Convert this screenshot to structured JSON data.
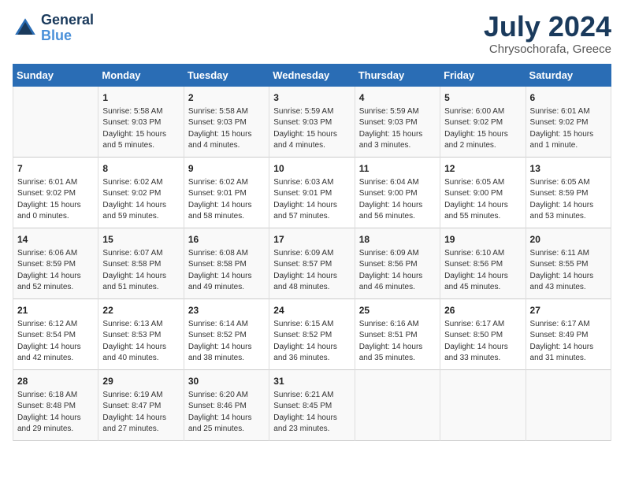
{
  "header": {
    "logo_line1": "General",
    "logo_line2": "Blue",
    "month": "July 2024",
    "location": "Chrysochorafa, Greece"
  },
  "weekdays": [
    "Sunday",
    "Monday",
    "Tuesday",
    "Wednesday",
    "Thursday",
    "Friday",
    "Saturday"
  ],
  "weeks": [
    [
      {
        "day": "",
        "info": ""
      },
      {
        "day": "1",
        "info": "Sunrise: 5:58 AM\nSunset: 9:03 PM\nDaylight: 15 hours\nand 5 minutes."
      },
      {
        "day": "2",
        "info": "Sunrise: 5:58 AM\nSunset: 9:03 PM\nDaylight: 15 hours\nand 4 minutes."
      },
      {
        "day": "3",
        "info": "Sunrise: 5:59 AM\nSunset: 9:03 PM\nDaylight: 15 hours\nand 4 minutes."
      },
      {
        "day": "4",
        "info": "Sunrise: 5:59 AM\nSunset: 9:03 PM\nDaylight: 15 hours\nand 3 minutes."
      },
      {
        "day": "5",
        "info": "Sunrise: 6:00 AM\nSunset: 9:02 PM\nDaylight: 15 hours\nand 2 minutes."
      },
      {
        "day": "6",
        "info": "Sunrise: 6:01 AM\nSunset: 9:02 PM\nDaylight: 15 hours\nand 1 minute."
      }
    ],
    [
      {
        "day": "7",
        "info": "Sunrise: 6:01 AM\nSunset: 9:02 PM\nDaylight: 15 hours\nand 0 minutes."
      },
      {
        "day": "8",
        "info": "Sunrise: 6:02 AM\nSunset: 9:02 PM\nDaylight: 14 hours\nand 59 minutes."
      },
      {
        "day": "9",
        "info": "Sunrise: 6:02 AM\nSunset: 9:01 PM\nDaylight: 14 hours\nand 58 minutes."
      },
      {
        "day": "10",
        "info": "Sunrise: 6:03 AM\nSunset: 9:01 PM\nDaylight: 14 hours\nand 57 minutes."
      },
      {
        "day": "11",
        "info": "Sunrise: 6:04 AM\nSunset: 9:00 PM\nDaylight: 14 hours\nand 56 minutes."
      },
      {
        "day": "12",
        "info": "Sunrise: 6:05 AM\nSunset: 9:00 PM\nDaylight: 14 hours\nand 55 minutes."
      },
      {
        "day": "13",
        "info": "Sunrise: 6:05 AM\nSunset: 8:59 PM\nDaylight: 14 hours\nand 53 minutes."
      }
    ],
    [
      {
        "day": "14",
        "info": "Sunrise: 6:06 AM\nSunset: 8:59 PM\nDaylight: 14 hours\nand 52 minutes."
      },
      {
        "day": "15",
        "info": "Sunrise: 6:07 AM\nSunset: 8:58 PM\nDaylight: 14 hours\nand 51 minutes."
      },
      {
        "day": "16",
        "info": "Sunrise: 6:08 AM\nSunset: 8:58 PM\nDaylight: 14 hours\nand 49 minutes."
      },
      {
        "day": "17",
        "info": "Sunrise: 6:09 AM\nSunset: 8:57 PM\nDaylight: 14 hours\nand 48 minutes."
      },
      {
        "day": "18",
        "info": "Sunrise: 6:09 AM\nSunset: 8:56 PM\nDaylight: 14 hours\nand 46 minutes."
      },
      {
        "day": "19",
        "info": "Sunrise: 6:10 AM\nSunset: 8:56 PM\nDaylight: 14 hours\nand 45 minutes."
      },
      {
        "day": "20",
        "info": "Sunrise: 6:11 AM\nSunset: 8:55 PM\nDaylight: 14 hours\nand 43 minutes."
      }
    ],
    [
      {
        "day": "21",
        "info": "Sunrise: 6:12 AM\nSunset: 8:54 PM\nDaylight: 14 hours\nand 42 minutes."
      },
      {
        "day": "22",
        "info": "Sunrise: 6:13 AM\nSunset: 8:53 PM\nDaylight: 14 hours\nand 40 minutes."
      },
      {
        "day": "23",
        "info": "Sunrise: 6:14 AM\nSunset: 8:52 PM\nDaylight: 14 hours\nand 38 minutes."
      },
      {
        "day": "24",
        "info": "Sunrise: 6:15 AM\nSunset: 8:52 PM\nDaylight: 14 hours\nand 36 minutes."
      },
      {
        "day": "25",
        "info": "Sunrise: 6:16 AM\nSunset: 8:51 PM\nDaylight: 14 hours\nand 35 minutes."
      },
      {
        "day": "26",
        "info": "Sunrise: 6:17 AM\nSunset: 8:50 PM\nDaylight: 14 hours\nand 33 minutes."
      },
      {
        "day": "27",
        "info": "Sunrise: 6:17 AM\nSunset: 8:49 PM\nDaylight: 14 hours\nand 31 minutes."
      }
    ],
    [
      {
        "day": "28",
        "info": "Sunrise: 6:18 AM\nSunset: 8:48 PM\nDaylight: 14 hours\nand 29 minutes."
      },
      {
        "day": "29",
        "info": "Sunrise: 6:19 AM\nSunset: 8:47 PM\nDaylight: 14 hours\nand 27 minutes."
      },
      {
        "day": "30",
        "info": "Sunrise: 6:20 AM\nSunset: 8:46 PM\nDaylight: 14 hours\nand 25 minutes."
      },
      {
        "day": "31",
        "info": "Sunrise: 6:21 AM\nSunset: 8:45 PM\nDaylight: 14 hours\nand 23 minutes."
      },
      {
        "day": "",
        "info": ""
      },
      {
        "day": "",
        "info": ""
      },
      {
        "day": "",
        "info": ""
      }
    ]
  ]
}
